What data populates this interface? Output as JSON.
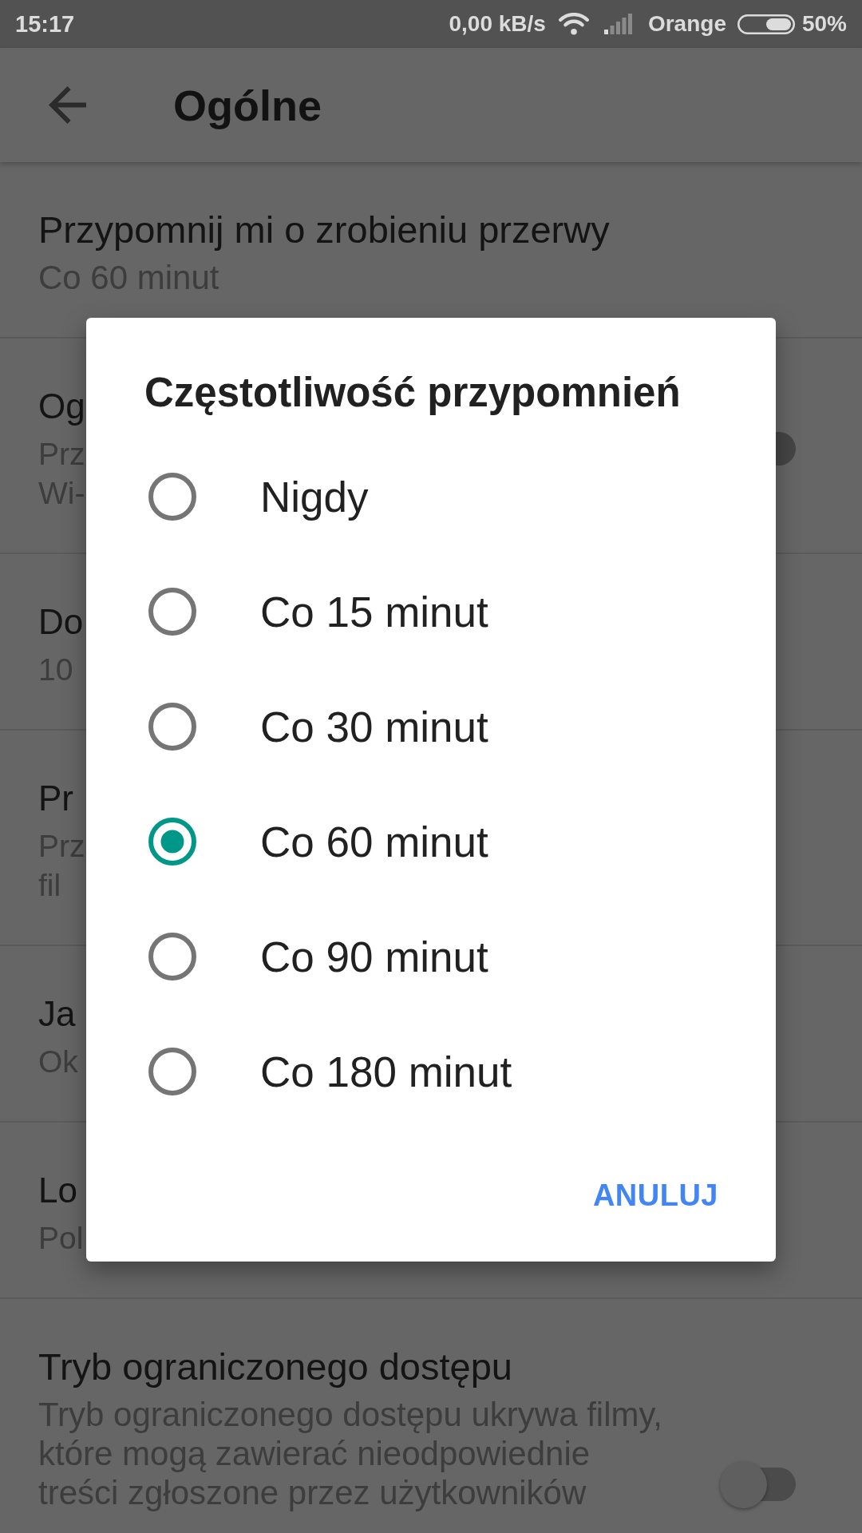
{
  "status_bar": {
    "time": "15:17",
    "speed": "0,00 kB/s",
    "carrier": "Orange",
    "battery": "50%"
  },
  "app_bar": {
    "title": "Ogólne"
  },
  "settings": [
    {
      "title": "Przypomnij mi o zrobieniu przerwy",
      "subtitle": "Co 60 minut"
    },
    {
      "title": "Og",
      "subtitle": "Prz\nWi-",
      "toggle": {
        "on": false
      }
    },
    {
      "title": "Do",
      "subtitle": "10"
    },
    {
      "title": "Pr",
      "subtitle": "Prz\nfil"
    },
    {
      "title": "Ja",
      "subtitle": "Ok"
    },
    {
      "title": "Lo",
      "subtitle": "Pol"
    },
    {
      "title": "Tryb ograniczonego dostępu",
      "subtitle": "Tryb ograniczonego dostępu ukrywa filmy,\nktóre mogą zawierać nieodpowiednie\ntreści zgłoszone przez użytkowników",
      "toggle": {
        "on": false
      }
    }
  ],
  "dialog": {
    "title": "Częstotliwość przypomnień",
    "options": [
      {
        "label": "Nigdy",
        "selected": false
      },
      {
        "label": "Co 15 minut",
        "selected": false
      },
      {
        "label": "Co 30 minut",
        "selected": false
      },
      {
        "label": "Co 60 minut",
        "selected": true
      },
      {
        "label": "Co 90 minut",
        "selected": false
      },
      {
        "label": "Co 180 minut",
        "selected": false
      }
    ],
    "buttons": [
      "ANULUJ"
    ]
  }
}
